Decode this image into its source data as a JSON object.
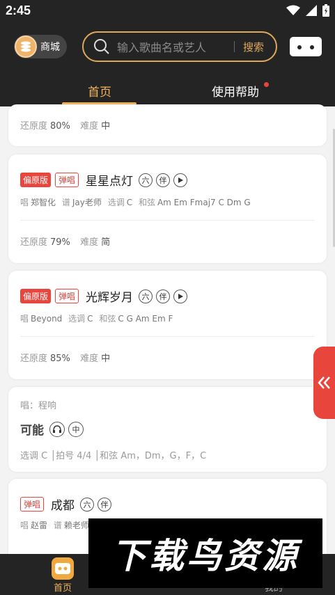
{
  "status_bar": {
    "time": "2:45"
  },
  "header": {
    "shop_label": "商城",
    "search_placeholder": "输入歌曲名或艺人",
    "search_button": "搜索"
  },
  "tabs": [
    {
      "label": "首页",
      "active": true
    },
    {
      "label": "使用帮助",
      "active": false,
      "has_dot": true
    }
  ],
  "cards": [
    {
      "accuracy_label": "还原度",
      "accuracy": "80%",
      "difficulty_label": "难度",
      "difficulty": "中"
    },
    {
      "badge_primary": "偏原版",
      "badge_secondary": "弹唱",
      "title": "星星点灯",
      "tag_six": "六",
      "tag_acc": "伴",
      "credits": {
        "sing_label": "唱",
        "singer": "郑智化",
        "score_label": "谱",
        "scorer": "Jay老师",
        "key_label": "选调",
        "key": "C",
        "chord_label": "和弦",
        "chords": "Am Em Fmaj7 C Dm G"
      },
      "accuracy_label": "还原度",
      "accuracy": "79%",
      "difficulty_label": "难度",
      "difficulty": "简"
    },
    {
      "badge_primary": "偏原版",
      "badge_secondary": "弹唱",
      "title": "光辉岁月",
      "tag_six": "六",
      "tag_acc": "伴",
      "credits": {
        "sing_label": "唱",
        "singer": "Beyond",
        "key_label": "选调",
        "key": "C",
        "chord_label": "和弦",
        "chords": "C G Am Em F"
      },
      "accuracy_label": "还原度",
      "accuracy": "85%",
      "difficulty_label": "难度",
      "difficulty": "中"
    },
    {
      "singer_line": "唱：程响",
      "title": "可能",
      "tag_mid": "中",
      "info_line": "选调 C │拍号 4/4 │和弦 Am，Dm，G，F，C"
    },
    {
      "badge_secondary": "弹唱",
      "title": "成都",
      "tag_six": "六",
      "tag_acc": "伴",
      "credits": {
        "sing_label": "唱",
        "singer": "赵雷",
        "score_label": "谱",
        "scorer": "赖老师"
      }
    }
  ],
  "bottom_nav": {
    "home_label": "首页",
    "mine_label": "我的"
  },
  "watermark": "下载鸟资源",
  "colors": {
    "accent": "#f2b35a",
    "red": "#e8453c",
    "dark": "#242424"
  }
}
